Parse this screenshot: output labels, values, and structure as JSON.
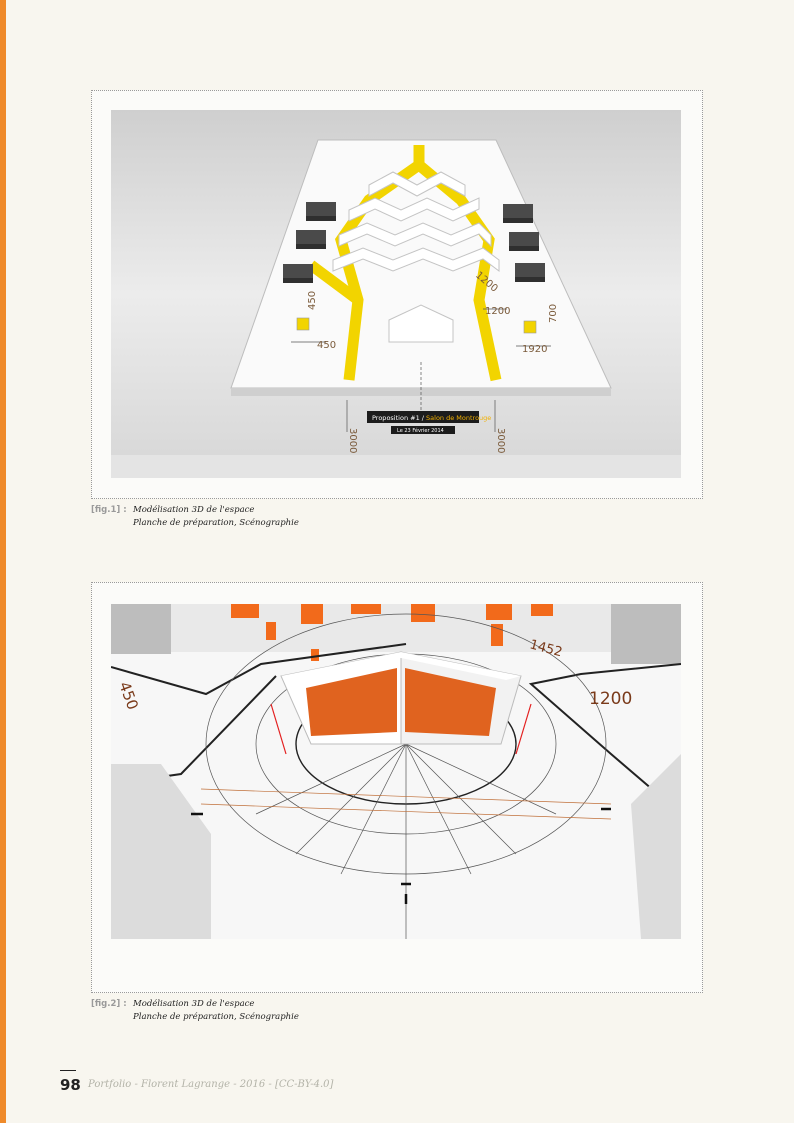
{
  "figures": [
    {
      "tag": "[fig.1] :",
      "caption_line1": "Modélisation 3D de l'espace",
      "caption_line2": "Planche de préparation, Scénographie",
      "image": {
        "sign_title": "Proposition #1 / ",
        "sign_highlight": "Salon de Montrouge",
        "sign_date": "Le 23 Février 2014",
        "dims": [
          "3000",
          "3000",
          "1200",
          "1200",
          "1920",
          "450",
          "450",
          "700"
        ],
        "accent": "#f2d400"
      }
    },
    {
      "tag": "[fig.2] :",
      "caption_line1": "Modélisation 3D de l'espace",
      "caption_line2": "Planche de préparation, Scénographie",
      "image": {
        "dims": [
          "1200",
          "1452",
          "450"
        ],
        "accent": "#f26a1b"
      }
    }
  ],
  "footer": {
    "page_number": "98",
    "text": "Portfolio - Florent Lagrange - 2016 - [CC-BY-4.0]"
  },
  "colors": {
    "side_bar": "#ef8a2a",
    "page_bg": "#f8f6ef"
  }
}
